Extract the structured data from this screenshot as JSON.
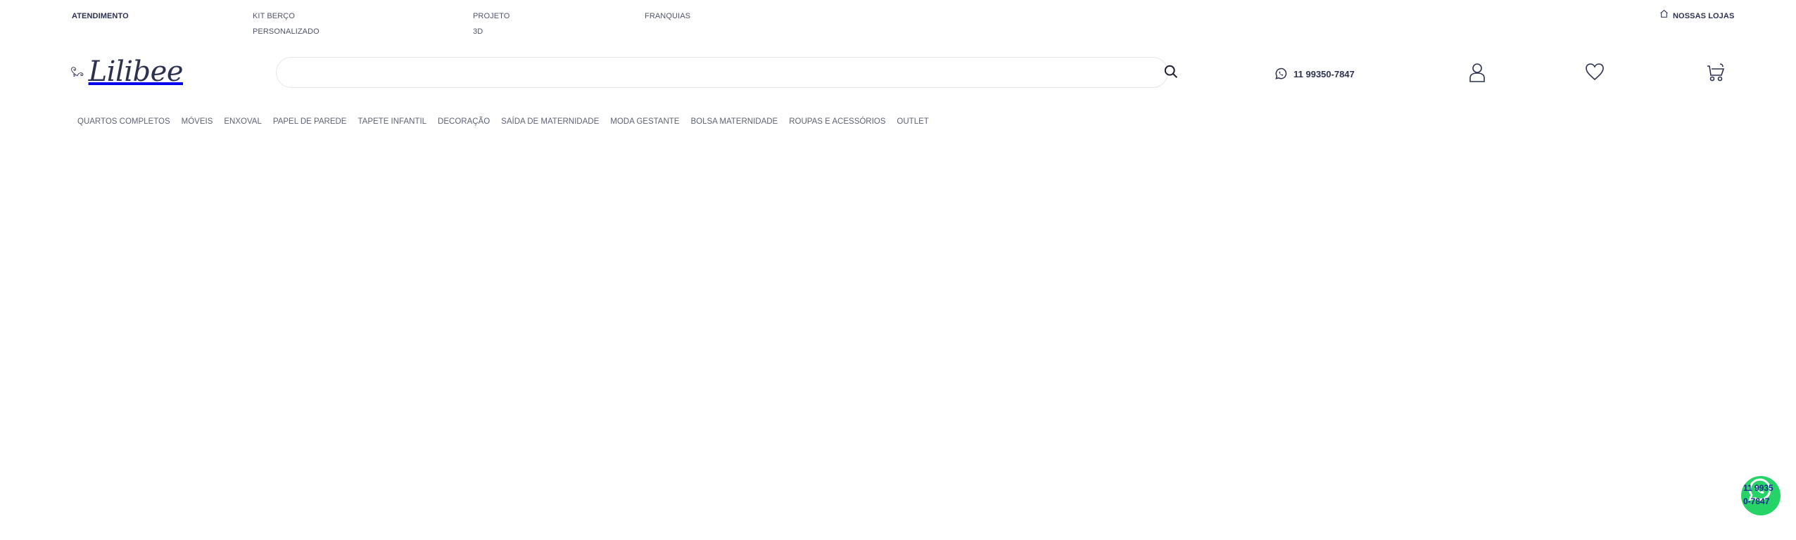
{
  "topbar": {
    "atendimento": "ATENDIMENTO",
    "kit_berco": "KIT BERÇO PERSONALIZADO",
    "projeto_3d": "PROJETO 3D",
    "franquias": "FRANQUIAS",
    "nossas_lojas": "NOSSAS LOJAS"
  },
  "brand": {
    "logo_text": "Lilibee"
  },
  "search": {
    "placeholder": ""
  },
  "contact": {
    "phone": "11 99350-7847"
  },
  "categories": [
    "QUARTOS COMPLETOS",
    "MÓVEIS",
    "ENXOVAL",
    "PAPEL DE PAREDE",
    "TAPETE INFANTIL",
    "DECORAÇÃO",
    "SAÍDA DE MATERNIDADE",
    "MODA GESTANTE",
    "BOLSA MATERNIDADE",
    "ROUPAS E ACESSÓRIOS",
    "OUTLET"
  ],
  "whatsapp_float": {
    "number": "11 99350-7847"
  },
  "colors": {
    "brand_navy": "#2d3150",
    "whatsapp_green": "#25d366",
    "float_text": "#1b2a8a"
  },
  "icons": [
    "home-icon",
    "search-icon",
    "whatsapp-icon",
    "user-icon",
    "heart-icon",
    "cart-icon"
  ]
}
